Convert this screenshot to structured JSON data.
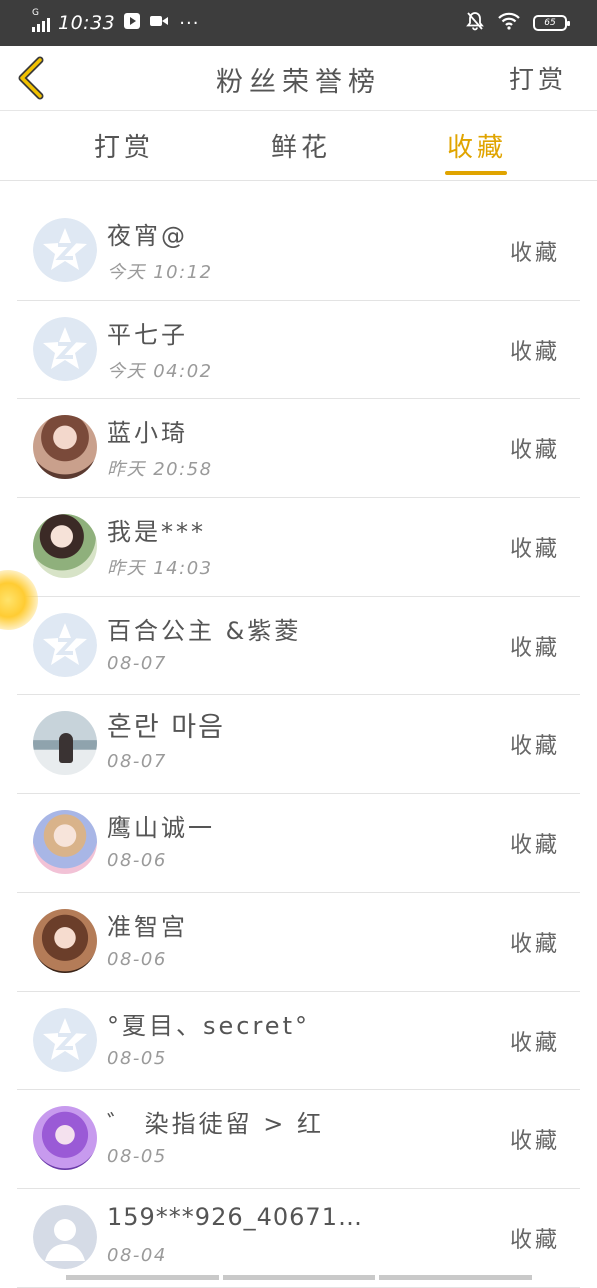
{
  "status_bar": {
    "signal": "G",
    "time": "10:33",
    "dots": "···",
    "battery": "65"
  },
  "header": {
    "title": "粉丝荣誉榜",
    "right_action": "打赏"
  },
  "tabs": [
    {
      "label": "打赏",
      "active": false
    },
    {
      "label": "鲜花",
      "active": false
    },
    {
      "label": "收藏",
      "active": true
    }
  ],
  "colors": {
    "accent": "#e0a400",
    "status_bar": "#3d3d3d",
    "text": "#555555",
    "muted": "#9a9a9a"
  },
  "items": [
    {
      "name": "夜宵@",
      "time": "今天 10:12",
      "action": "收藏",
      "avatar": "default-logo"
    },
    {
      "name": "平七子",
      "time": "今天 04:02",
      "action": "收藏",
      "avatar": "default-logo"
    },
    {
      "name": "蓝小琦",
      "time": "昨天 20:58",
      "action": "收藏",
      "avatar": "anime-avatar"
    },
    {
      "name": "我是***",
      "time": "昨天 14:03",
      "action": "收藏",
      "avatar": "anime-avatar"
    },
    {
      "name": "百合公主 &紫菱",
      "time": "08-07",
      "action": "收藏",
      "avatar": "default-logo"
    },
    {
      "name": "혼란 마음",
      "time": "08-07",
      "action": "收藏",
      "avatar": "photo-avatar"
    },
    {
      "name": "鹰山诚一",
      "time": "08-06",
      "action": "收藏",
      "avatar": "anime-avatar"
    },
    {
      "name": "准智宫",
      "time": "08-06",
      "action": "收藏",
      "avatar": "anime-avatar"
    },
    {
      "name": "°夏目、secret°",
      "time": "08-05",
      "action": "收藏",
      "avatar": "default-logo"
    },
    {
      "name": "゛ 染指徒留 > 红",
      "time": "08-05",
      "action": "收藏",
      "avatar": "anime-avatar"
    },
    {
      "name": "159***926_40671…",
      "time": "08-04",
      "action": "收藏",
      "avatar": "person-placeholder"
    }
  ]
}
